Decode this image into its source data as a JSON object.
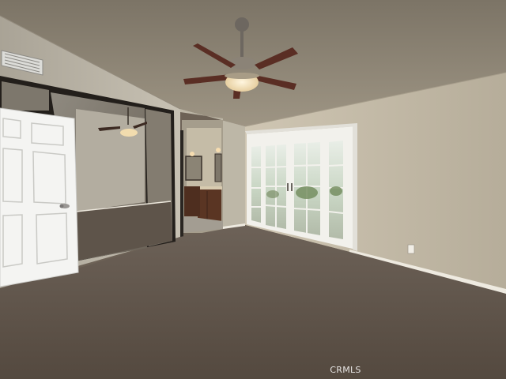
{
  "watermark": {
    "text": "CRMLS"
  },
  "colors": {
    "ceiling": "#8e8474",
    "wall_left": "#b9b3a4",
    "wall_right": "#c2b9a6",
    "carpet": "#5c5148",
    "door_white": "#f4f4f2",
    "frame_dark": "#2a2622",
    "glass_light": "#e8efe4",
    "vanity": "#5a3523",
    "fan_blade": "#5a2e24",
    "lamp": "#f3e3c2"
  },
  "icons": [
    "ceiling-fan-icon",
    "hvac-vent-icon",
    "door-knob-icon",
    "outlet-icon"
  ]
}
